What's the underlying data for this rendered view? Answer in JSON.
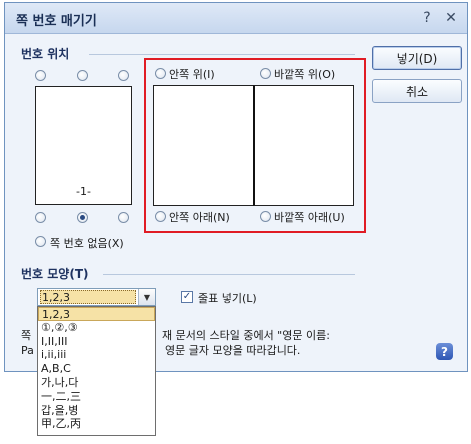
{
  "dialog": {
    "title": "쪽 번호 매기기",
    "help_glyph": "?",
    "close_glyph": "✕"
  },
  "position": {
    "label": "번호 위치",
    "inner_top": "안쪽 위(I)",
    "outer_top": "바깥쪽 위(O)",
    "inner_bottom": "안쪽 아래(N)",
    "outer_bottom": "바깥쪽 아래(U)",
    "no_number": "쪽 번호 없음(X)",
    "preview_number": "-1-",
    "selected": "bottom-center"
  },
  "buttons": {
    "insert": "넣기(D)",
    "cancel": "취소"
  },
  "format": {
    "label": "번호 모양(T)",
    "selected": "1,2,3",
    "options": [
      "1,2,3",
      "①,②,③",
      "I,II,III",
      "i,ii,iii",
      "A,B,C",
      "가,나,다",
      "一,二,三",
      "갑,을,병",
      "甲,乙,丙"
    ],
    "line_break_label": "줄표 넣기(L)",
    "line_break_checked": true
  },
  "description": {
    "line1_start": "쪽",
    "line1_end": "재 문서의 스타일 중에서 \"영문 이름:",
    "line2_start": "Pa",
    "line2_end": "영문 글자 모양을 따라갑니다."
  },
  "colors": {
    "highlight_box": "#e01b24",
    "selection": "#f6e2a6"
  }
}
